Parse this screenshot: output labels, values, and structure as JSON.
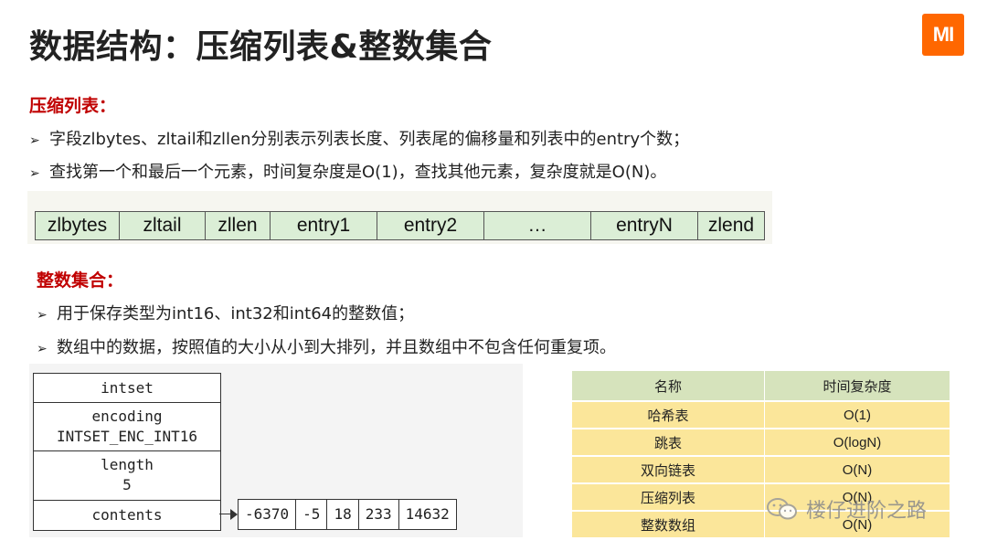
{
  "title": "数据结构：压缩列表&整数集合",
  "logo_text": "MI",
  "zip": {
    "heading": "压缩列表：",
    "bullets": [
      "字段zlbytes、zltail和zllen分别表示列表长度、列表尾的偏移量和列表中的entry个数；",
      "查找第一个和最后一个元素，时间复杂度是O(1)，查找其他元素，复杂度就是O(N)。"
    ],
    "cells": [
      "zlbytes",
      "zltail",
      "zllen",
      "entry1",
      "entry2",
      "…",
      "entryN",
      "zlend"
    ]
  },
  "intset": {
    "heading": "整数集合：",
    "bullets": [
      "用于保存类型为int16、int32和int64的整数值；",
      "数组中的数据，按照值的大小从小到大排列，并且数组中不包含任何重复项。"
    ],
    "name": "intset",
    "encoding_label": "encoding",
    "encoding_value": "INTSET_ENC_INT16",
    "length_label": "length",
    "length_value": "5",
    "contents_label": "contents",
    "contents": [
      "-6370",
      "-5",
      "18",
      "233",
      "14632"
    ]
  },
  "complexity_table": {
    "headers": [
      "名称",
      "时间复杂度"
    ],
    "rows": [
      [
        "哈希表",
        "O(1)"
      ],
      [
        "跳表",
        "O(logN)"
      ],
      [
        "双向链表",
        "O(N)"
      ],
      [
        "压缩列表",
        "O(N)"
      ],
      [
        "整数数组",
        "O(N)"
      ]
    ]
  },
  "watermark": "楼仔进阶之路",
  "colors": {
    "accent_red": "#c00000",
    "logo_orange": "#ff6700",
    "zip_cell_bg": "#dbeed6",
    "table_header_bg": "#d6e3bc",
    "table_row_bg": "#fbe69a"
  }
}
